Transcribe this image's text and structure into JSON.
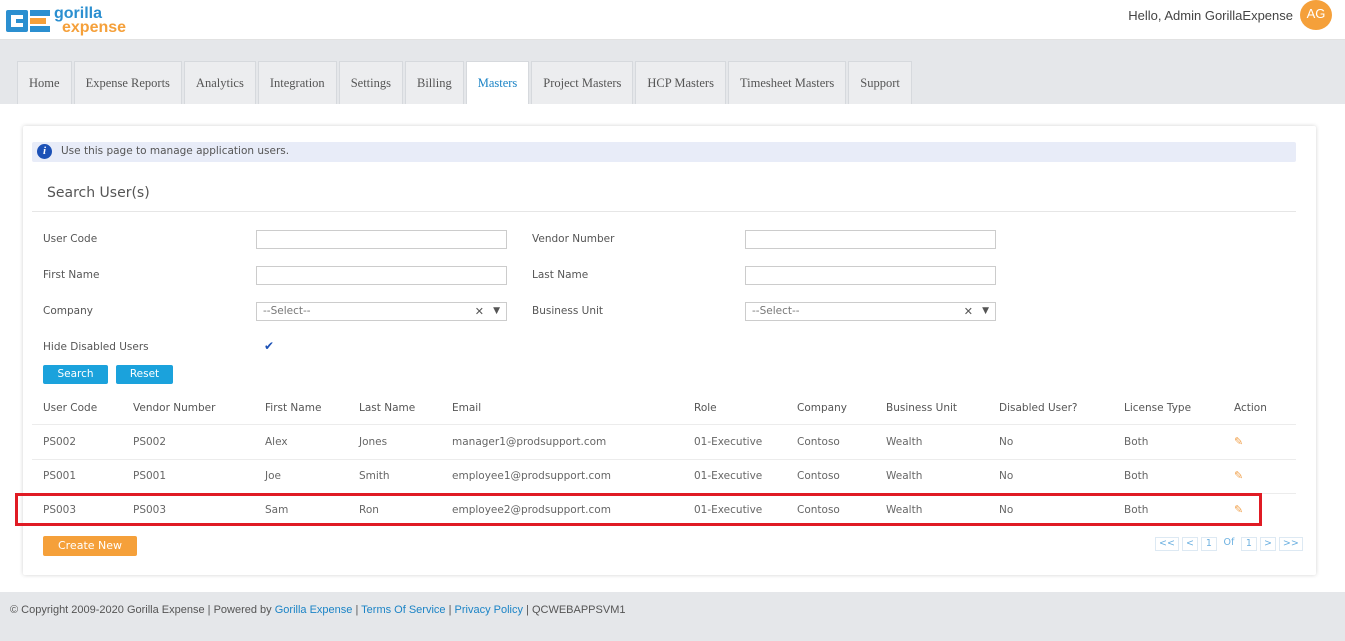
{
  "header": {
    "logo_top": "gorilla",
    "logo_bottom": "expense",
    "greeting": "Hello, Admin GorillaExpense",
    "avatar_initials": "AG",
    "brand_blue": "#2b8fd0",
    "brand_orange": "#f5a03a"
  },
  "tabs": [
    {
      "label": "Home",
      "active": false
    },
    {
      "label": "Expense Reports",
      "active": false
    },
    {
      "label": "Analytics",
      "active": false
    },
    {
      "label": "Integration",
      "active": false
    },
    {
      "label": "Settings",
      "active": false
    },
    {
      "label": "Billing",
      "active": false
    },
    {
      "label": "Masters",
      "active": true
    },
    {
      "label": "Project Masters",
      "active": false
    },
    {
      "label": "HCP Masters",
      "active": false
    },
    {
      "label": "Timesheet Masters",
      "active": false
    },
    {
      "label": "Support",
      "active": false
    }
  ],
  "info": {
    "icon": "info-icon",
    "text": "Use this page to manage application users."
  },
  "search": {
    "title": "Search User(s)",
    "user_code_label": "User Code",
    "user_code_value": "",
    "vendor_number_label": "Vendor Number",
    "vendor_number_value": "",
    "first_name_label": "First Name",
    "first_name_value": "",
    "last_name_label": "Last Name",
    "last_name_value": "",
    "company_label": "Company",
    "company_value": "--Select--",
    "business_unit_label": "Business Unit",
    "business_unit_value": "--Select--",
    "hide_disabled_label": "Hide Disabled Users",
    "hide_disabled_checked": true,
    "search_button": "Search",
    "reset_button": "Reset"
  },
  "table": {
    "columns": [
      "User Code",
      "Vendor Number",
      "First Name",
      "Last Name",
      "Email",
      "Role",
      "Company",
      "Business Unit",
      "Disabled User?",
      "License Type",
      "Action"
    ],
    "rows": [
      [
        "PS002",
        "PS002",
        "Alex",
        "Jones",
        "manager1@prodsupport.com",
        "01-Executive",
        "Contoso",
        "Wealth",
        "No",
        "Both"
      ],
      [
        "PS001",
        "PS001",
        "Joe",
        "Smith",
        "employee1@prodsupport.com",
        "01-Executive",
        "Contoso",
        "Wealth",
        "No",
        "Both"
      ],
      [
        "PS003",
        "PS003",
        "Sam",
        "Ron",
        "employee2@prodsupport.com",
        "01-Executive",
        "Contoso",
        "Wealth",
        "No",
        "Both"
      ]
    ],
    "highlighted_row": 2,
    "highlight_color": "#e01b24"
  },
  "create_new_button": "Create New",
  "pager": {
    "first": "<<",
    "prev": "<",
    "current_page": "1",
    "of_label": "Of",
    "total_pages": "1",
    "next": ">",
    "last": ">>"
  },
  "footer": {
    "copyright": "© Copyright 2009-2020 Gorilla Expense | Powered by ",
    "powered_link": "Gorilla Expense",
    "sep1": " | ",
    "terms": "Terms Of Service",
    "sep2": " | ",
    "privacy": "Privacy Policy",
    "server": " | QCWEBAPPSVM1"
  }
}
